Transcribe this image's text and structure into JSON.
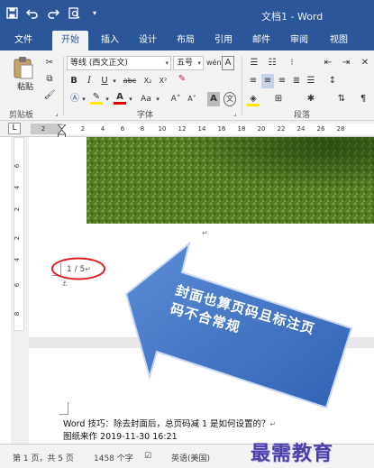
{
  "titlebar": {
    "title": "文档1 - Word",
    "icons": [
      "save-icon",
      "undo-icon",
      "redo-icon",
      "print-preview-icon"
    ]
  },
  "tabs": [
    "文件",
    "开始",
    "插入",
    "设计",
    "布局",
    "引用",
    "邮件",
    "审阅",
    "视图"
  ],
  "ribbon": {
    "clipboard": {
      "paste_label": "粘贴",
      "group_label": "剪贴板"
    },
    "font": {
      "font_name": "等线 (西文正文)",
      "font_size": "五号",
      "group_label": "字体",
      "bold": "B",
      "italic": "I",
      "underline": "U",
      "strike": "abc",
      "subscript": "X₂",
      "superscript": "X²",
      "grow": "A˄",
      "shrink": "A˅",
      "case": "Aa",
      "wen": "文",
      "char_box": "A"
    },
    "paragraph": {
      "group_label": "段落"
    },
    "accent_color": "#2b579a"
  },
  "ruler": {
    "numbers": [
      "2",
      "2",
      "4",
      "6",
      "8",
      "10",
      "12",
      "14",
      "16",
      "18",
      "20",
      "22",
      "24",
      "26",
      "28"
    ],
    "corner": "L"
  },
  "vruler": {
    "numbers": [
      "6",
      "4",
      "2",
      "2",
      "4",
      "6",
      "8"
    ]
  },
  "document": {
    "page_number_text": "1 / 5",
    "callout_text": "封面也算页码且标注页码不合常规",
    "body_line": "Word 技巧：除去封面后，总页码减 1 是如何设置的？",
    "body_line2": "图纸来作  2019-11-30 16:21"
  },
  "statusbar": {
    "page": "第 1 页，共 5 页",
    "words": "1458 个字",
    "lang": "英语(美国)"
  },
  "watermark": "最需教育"
}
